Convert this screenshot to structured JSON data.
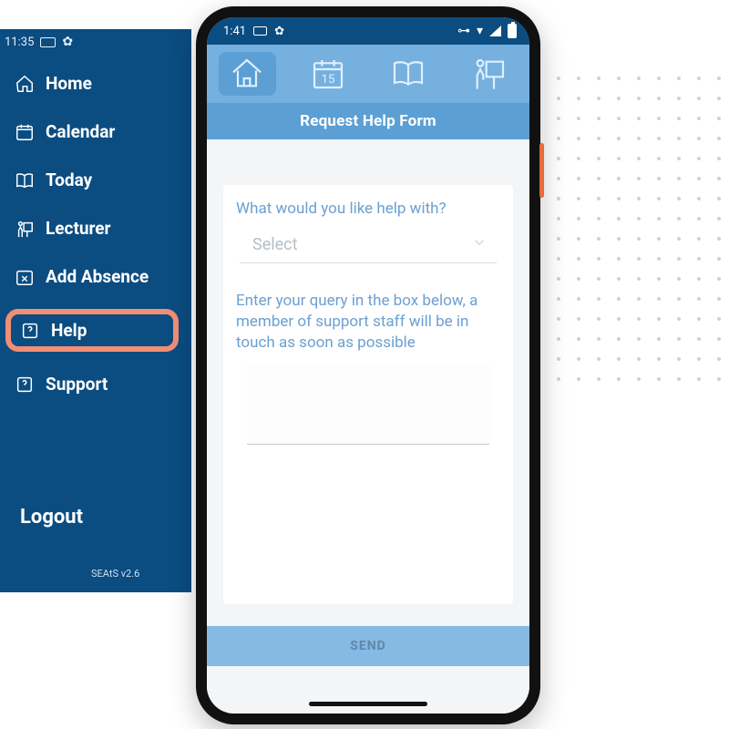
{
  "sidebar": {
    "status_time": "11:35",
    "items": [
      {
        "label": "Home"
      },
      {
        "label": "Calendar"
      },
      {
        "label": "Today"
      },
      {
        "label": "Lecturer"
      },
      {
        "label": "Add Absence"
      },
      {
        "label": "Help"
      },
      {
        "label": "Support"
      }
    ],
    "logout_label": "Logout",
    "version_label": "SEAtS v2.6"
  },
  "phone": {
    "status_time": "1:41",
    "title": "Request Help Form",
    "topnav": {
      "calendar_number": "15"
    },
    "form": {
      "q1_label": "What would you like help with?",
      "select_placeholder": "Select",
      "q2_label": "Enter your query in the box below, a member of support staff will be in touch as soon as possible",
      "send_label": "SEND"
    }
  }
}
